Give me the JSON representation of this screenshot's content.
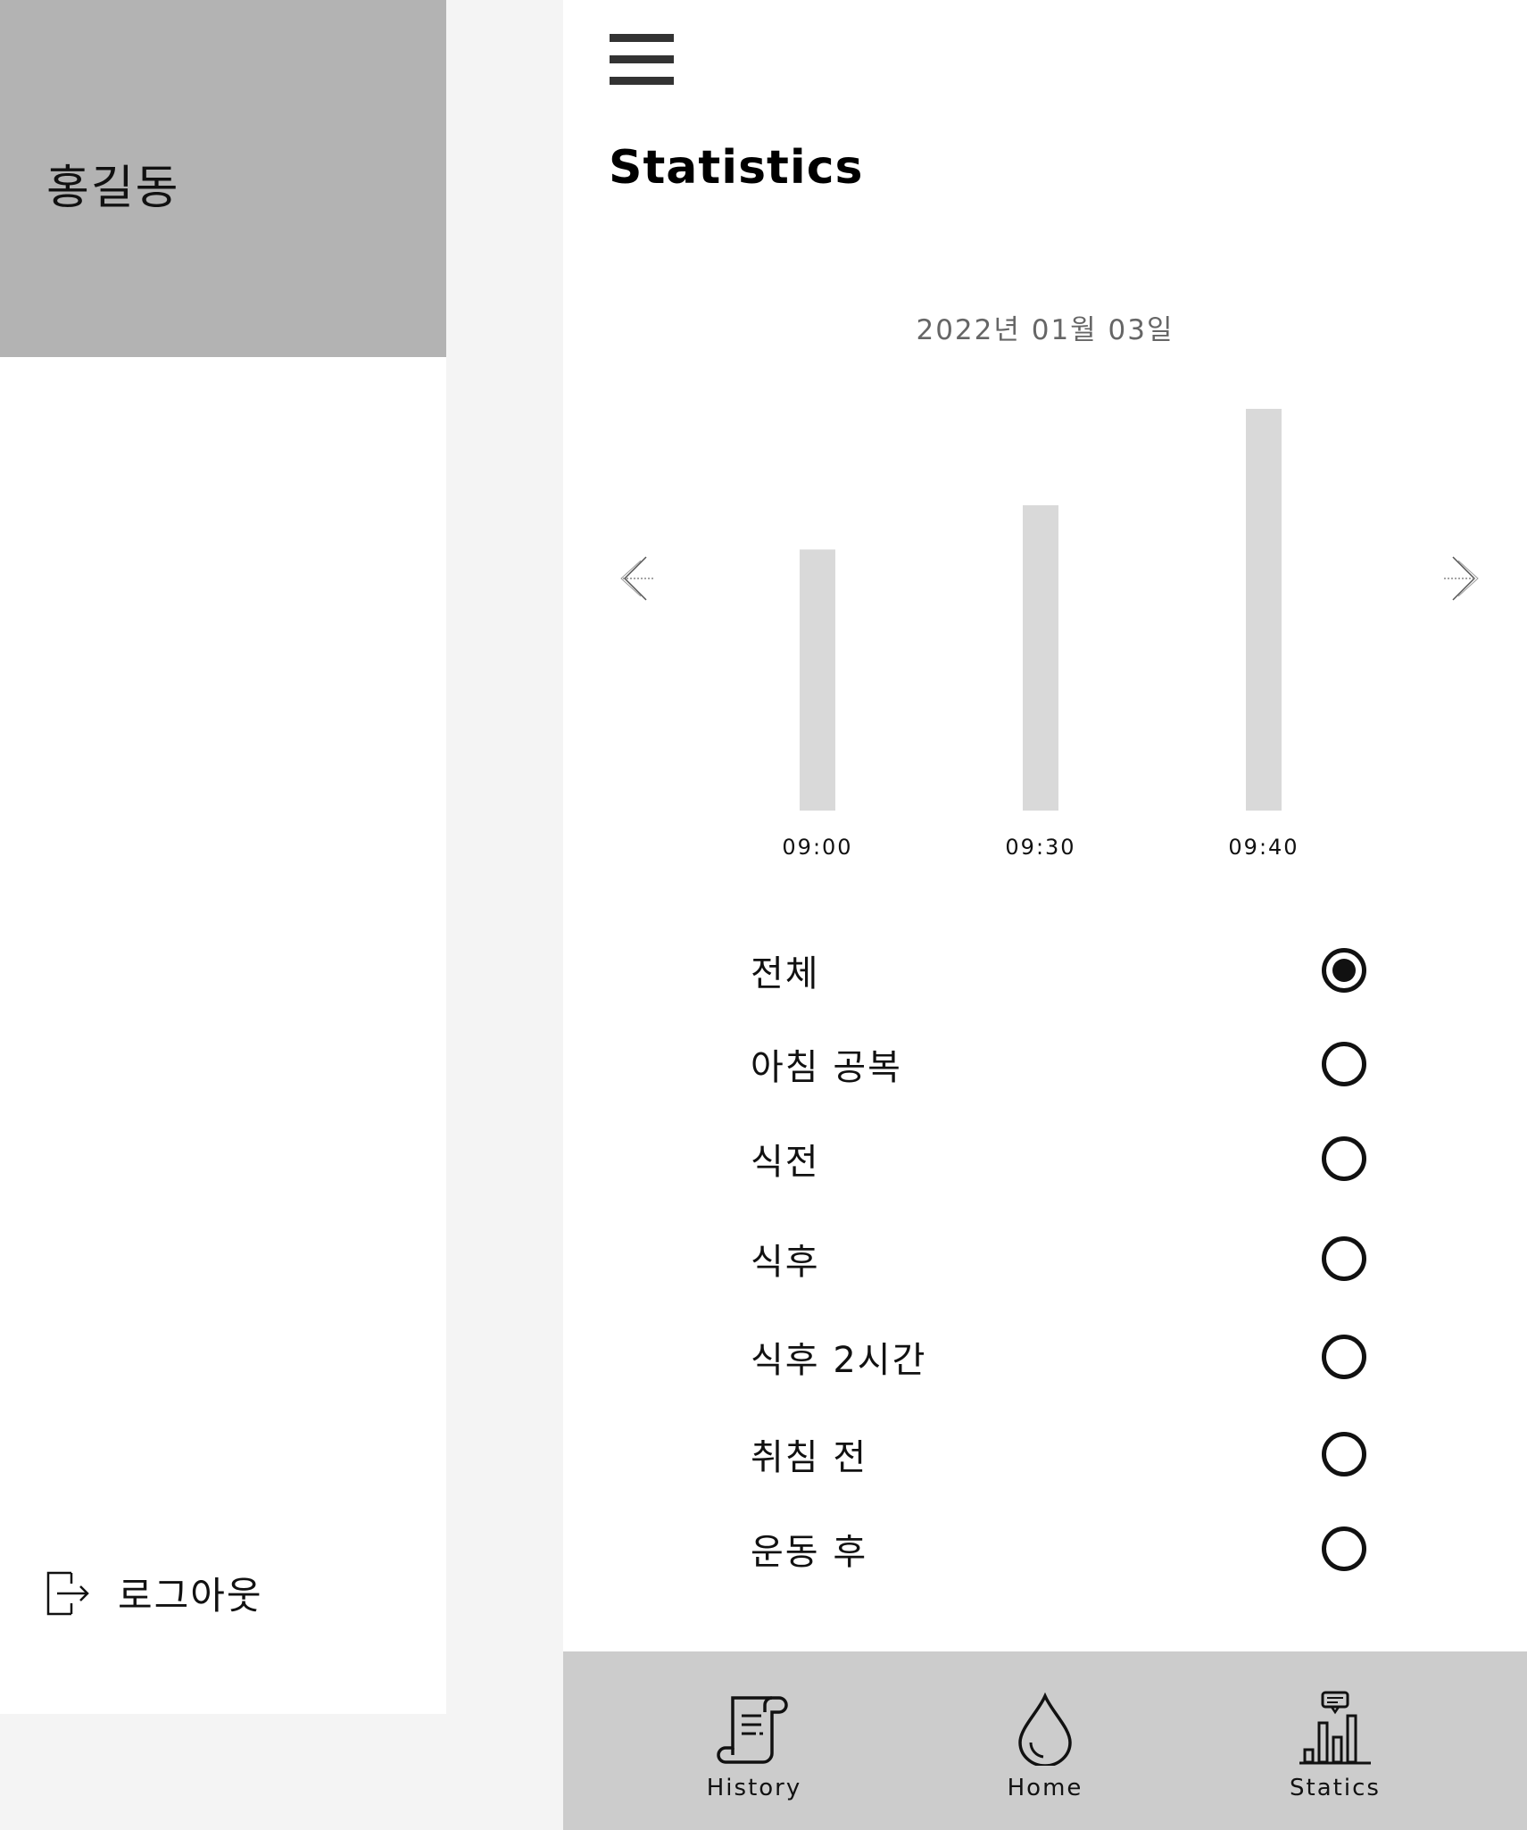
{
  "drawer": {
    "user_name": "홍길동",
    "logout_label": "로그아웃",
    "logout_icon": "logout-icon"
  },
  "header": {
    "menu_icon": "hamburger-menu-icon",
    "title": "Statistics"
  },
  "chart": {
    "date": "2022년 01월 03일",
    "prev_icon": "arrow-left-icon",
    "next_icon": "arrow-right-icon"
  },
  "chart_data": {
    "type": "bar",
    "categories": [
      "09:00",
      "09:30",
      "09:40"
    ],
    "values": [
      65,
      76,
      100
    ],
    "ylim": [
      0,
      100
    ],
    "grid": false,
    "bar_color": "#d9d9d9"
  },
  "options": [
    {
      "label": "전체",
      "checked": true
    },
    {
      "label": "아침 공복",
      "checked": false
    },
    {
      "label": "식전",
      "checked": false
    },
    {
      "label": "식후",
      "checked": false
    },
    {
      "label": "식후 2시간",
      "checked": false
    },
    {
      "label": "취침 전",
      "checked": false
    },
    {
      "label": "운동 후",
      "checked": false
    }
  ],
  "bottom_nav": {
    "tabs": [
      {
        "label": "History",
        "icon": "scroll-icon"
      },
      {
        "label": "Home",
        "icon": "water-drop-icon"
      },
      {
        "label": "Statics",
        "icon": "bar-chart-icon"
      }
    ]
  },
  "colors": {
    "drawer_header": "#b3b3b3",
    "bottom_nav": "#cccccc",
    "background": "#f4f4f4",
    "bar": "#d9d9d9"
  }
}
